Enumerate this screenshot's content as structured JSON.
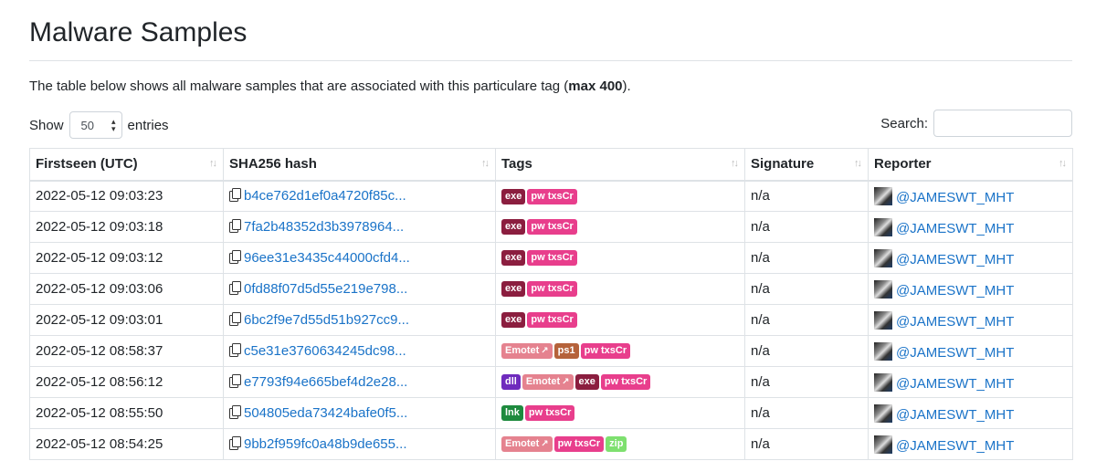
{
  "page": {
    "title": "Malware Samples",
    "description_pre": "The table below shows all malware samples that are associated with this particulare tag (",
    "description_bold": "max 400",
    "description_post": ")."
  },
  "controls": {
    "show_label": "Show",
    "entries_value": "50",
    "entries_label": "entries",
    "search_label": "Search:",
    "search_value": ""
  },
  "table": {
    "columns": [
      "Firstseen (UTC)",
      "SHA256 hash",
      "Tags",
      "Signature",
      "Reporter"
    ],
    "sort_icon": "sort-arrows-icon",
    "copy_icon": "copy-icon",
    "tag_colors": {
      "exe": "#8b1e3f",
      "pw txsCr": "#e83e8c",
      "Emotet": "#e5828f",
      "ps1": "#b5623a",
      "dll": "#6f2bbd",
      "lnk": "#1e8a3e",
      "zip": "#7ee06f"
    },
    "rows": [
      {
        "firstseen": "2022-05-12 09:03:23",
        "hash": "b4ce762d1ef0a4720f85c...",
        "tags": [
          {
            "label": "exe"
          },
          {
            "label": "pw txsCr"
          }
        ],
        "signature": "n/a",
        "reporter": "@JAMESWT_MHT"
      },
      {
        "firstseen": "2022-05-12 09:03:18",
        "hash": "7fa2b48352d3b3978964...",
        "tags": [
          {
            "label": "exe"
          },
          {
            "label": "pw txsCr"
          }
        ],
        "signature": "n/a",
        "reporter": "@JAMESWT_MHT"
      },
      {
        "firstseen": "2022-05-12 09:03:12",
        "hash": "96ee31e3435c44000cfd4...",
        "tags": [
          {
            "label": "exe"
          },
          {
            "label": "pw txsCr"
          }
        ],
        "signature": "n/a",
        "reporter": "@JAMESWT_MHT"
      },
      {
        "firstseen": "2022-05-12 09:03:06",
        "hash": "0fd88f07d5d55e219e798...",
        "tags": [
          {
            "label": "exe"
          },
          {
            "label": "pw txsCr"
          }
        ],
        "signature": "n/a",
        "reporter": "@JAMESWT_MHT"
      },
      {
        "firstseen": "2022-05-12 09:03:01",
        "hash": "6bc2f9e7d55d51b927cc9...",
        "tags": [
          {
            "label": "exe"
          },
          {
            "label": "pw txsCr"
          }
        ],
        "signature": "n/a",
        "reporter": "@JAMESWT_MHT"
      },
      {
        "firstseen": "2022-05-12 08:58:37",
        "hash": "c5e31e3760634245dc98...",
        "tags": [
          {
            "label": "Emotet",
            "link": true
          },
          {
            "label": "ps1"
          },
          {
            "label": "pw txsCr"
          }
        ],
        "signature": "n/a",
        "reporter": "@JAMESWT_MHT"
      },
      {
        "firstseen": "2022-05-12 08:56:12",
        "hash": "e7793f94e665bef4d2e28...",
        "tags": [
          {
            "label": "dll"
          },
          {
            "label": "Emotet",
            "link": true
          },
          {
            "label": "exe"
          },
          {
            "label": "pw txsCr"
          }
        ],
        "signature": "n/a",
        "reporter": "@JAMESWT_MHT"
      },
      {
        "firstseen": "2022-05-12 08:55:50",
        "hash": "504805eda73424bafe0f5...",
        "tags": [
          {
            "label": "lnk"
          },
          {
            "label": "pw txsCr"
          }
        ],
        "signature": "n/a",
        "reporter": "@JAMESWT_MHT"
      },
      {
        "firstseen": "2022-05-12 08:54:25",
        "hash": "9bb2f959fc0a48b9de655...",
        "tags": [
          {
            "label": "Emotet",
            "link": true
          },
          {
            "label": "pw txsCr"
          },
          {
            "label": "zip"
          }
        ],
        "signature": "n/a",
        "reporter": "@JAMESWT_MHT"
      }
    ]
  }
}
